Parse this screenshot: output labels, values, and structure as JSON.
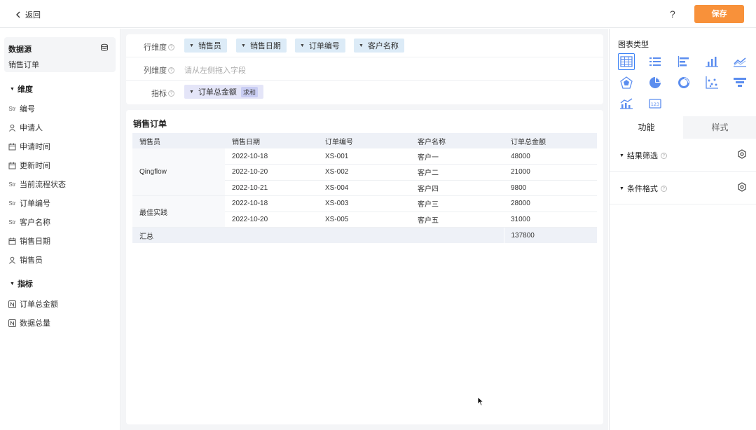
{
  "header": {
    "back_label": "返回",
    "help_symbol": "?",
    "save_label": "保存"
  },
  "sidebar": {
    "datasource_title": "数据源",
    "datasource_name": "销售订单",
    "dimensions_title": "维度",
    "dimensions": [
      {
        "icon": "Str",
        "label": "编号"
      },
      {
        "icon": "person-icon",
        "label": "申请人"
      },
      {
        "icon": "calendar-icon",
        "label": "申请时间"
      },
      {
        "icon": "calendar-icon",
        "label": "更新时间"
      },
      {
        "icon": "Str",
        "label": "当前流程状态"
      },
      {
        "icon": "Str",
        "label": "订单编号"
      },
      {
        "icon": "Str",
        "label": "客户名称"
      },
      {
        "icon": "calendar-icon",
        "label": "销售日期"
      },
      {
        "icon": "person-icon",
        "label": "销售员"
      }
    ],
    "metrics_title": "指标",
    "metrics": [
      {
        "icon": "N",
        "label": "订单总金额"
      },
      {
        "icon": "N",
        "label": "数据总量"
      }
    ]
  },
  "config": {
    "row_label": "行维度",
    "row_fields": [
      "销售员",
      "销售日期",
      "订单编号",
      "客户名称"
    ],
    "col_label": "列维度",
    "col_placeholder": "请从左侧拖入字段",
    "metric_label": "指标",
    "metric_field": "订单总金额",
    "metric_agg": "求和"
  },
  "table": {
    "title": "销售订单",
    "headers": [
      "销售员",
      "销售日期",
      "订单编号",
      "客户名称",
      "订单总金额"
    ],
    "rows": [
      {
        "date": "2022-10-18",
        "order": "XS-001",
        "customer": "客户一",
        "amount": "48000"
      },
      {
        "date": "2022-10-20",
        "order": "XS-002",
        "customer": "客户二",
        "amount": "21000"
      },
      {
        "date": "2022-10-21",
        "order": "XS-004",
        "customer": "客户四",
        "amount": "9800"
      },
      {
        "date": "2022-10-18",
        "order": "XS-003",
        "customer": "客户三",
        "amount": "28000"
      },
      {
        "date": "2022-10-20",
        "order": "XS-005",
        "customer": "客户五",
        "amount": "31000"
      }
    ],
    "groups": [
      "Qingflow",
      "最佳实践"
    ],
    "total_label": "汇总",
    "total_value": "137800"
  },
  "panel": {
    "chart_type_title": "图表类型",
    "chart_types": [
      "table-icon",
      "list-icon",
      "horizontal-bar-icon",
      "bar-chart-icon",
      "line-chart-icon",
      "radar-icon",
      "pie-chart-icon",
      "donut-icon",
      "scatter-icon",
      "funnel-icon",
      "combo-chart-icon",
      "number-card-icon"
    ],
    "tab_function": "功能",
    "tab_style": "样式",
    "result_filter": "结果筛选",
    "conditional_format": "条件格式"
  },
  "colors": {
    "accent": "#f8913a",
    "selected": "#3b82f6",
    "chip": "#dcebf7",
    "chart_icon": "#5b8def"
  }
}
